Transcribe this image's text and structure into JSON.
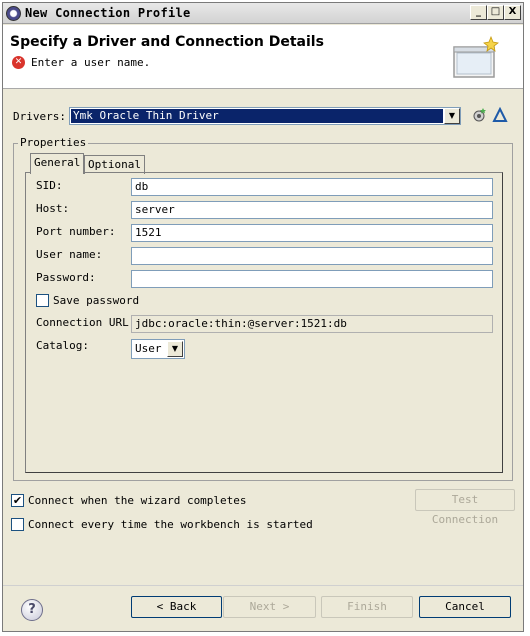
{
  "window": {
    "title": "New Connection Profile",
    "controls": {
      "minimize": "_",
      "maximize": "□",
      "close": "X"
    }
  },
  "banner": {
    "title": "Specify a Driver and Connection Details",
    "message": "Enter a user name."
  },
  "drivers": {
    "label": "Drivers:",
    "selected": "Ymk Oracle Thin Driver"
  },
  "properties": {
    "legend": "Properties",
    "tabs": [
      {
        "label": "General",
        "active": true
      },
      {
        "label": "Optional",
        "active": false
      }
    ],
    "fields": {
      "sid": {
        "label": "SID:",
        "value": "db"
      },
      "host": {
        "label": "Host:",
        "value": "server"
      },
      "port": {
        "label": "Port number:",
        "value": "1521"
      },
      "user": {
        "label": "User name:",
        "value": ""
      },
      "password": {
        "label": "Password:",
        "value": ""
      }
    },
    "save_password": {
      "label": "Save password",
      "checked": false
    },
    "connection_url": {
      "label": "Connection URL:",
      "value": "jdbc:oracle:thin:@server:1521:db"
    },
    "catalog": {
      "label": "Catalog:",
      "selected": "User"
    }
  },
  "options": {
    "connect_when_complete": {
      "label": "Connect when the wizard completes",
      "checked": true
    },
    "connect_every_time": {
      "label": "Connect every time the workbench is started",
      "checked": false
    },
    "test_connection": "Test Connection"
  },
  "footer": {
    "back": "< Back",
    "next": "Next >",
    "finish": "Finish",
    "cancel": "Cancel"
  },
  "colors": {
    "selection": "#0a246a",
    "error": "#d9342c",
    "window_bg": "#ece9d8"
  }
}
